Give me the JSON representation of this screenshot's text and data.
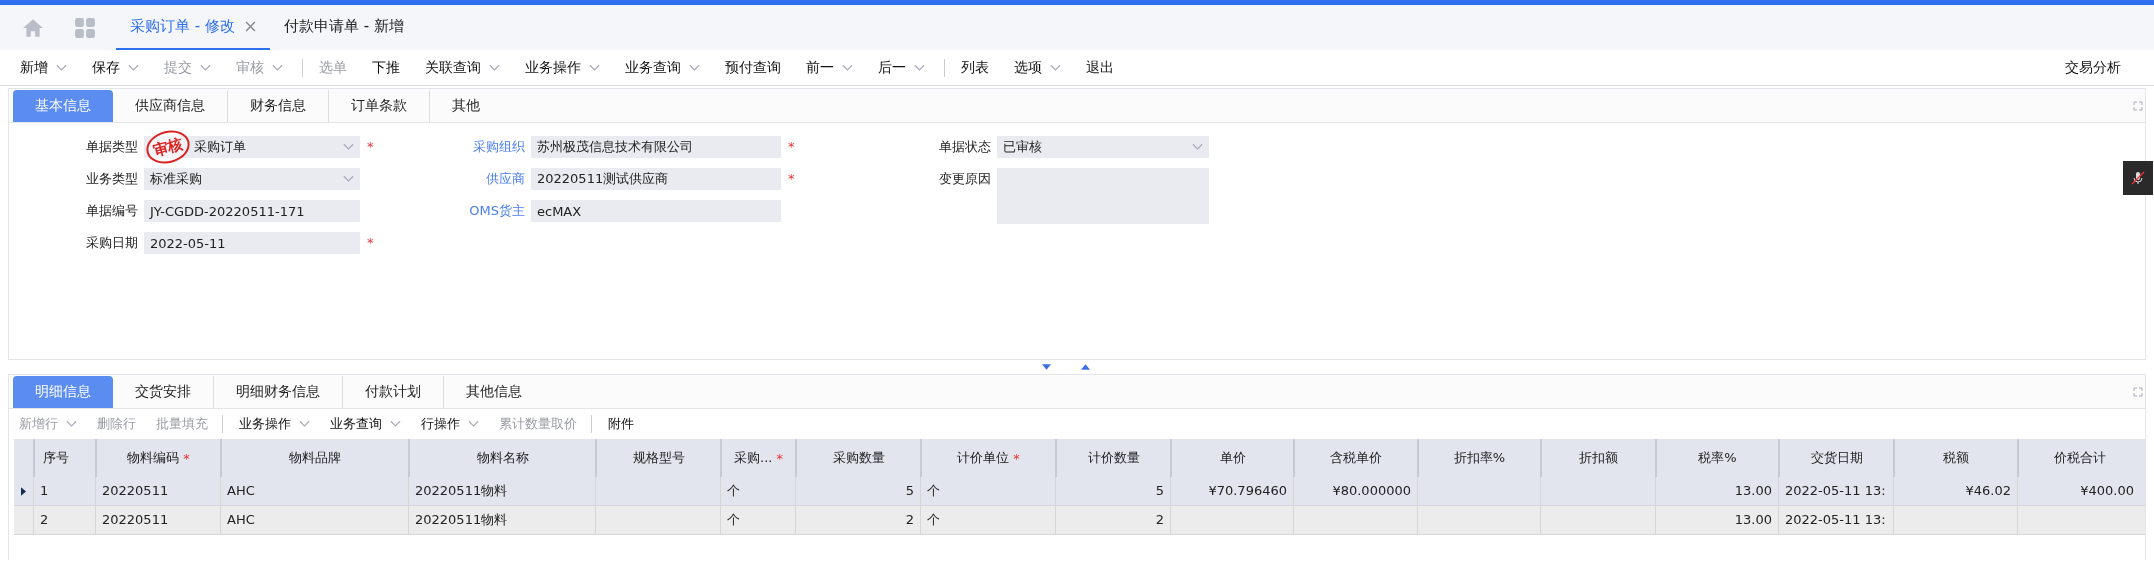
{
  "doc_tabs": [
    {
      "label": "采购订单 - 修改",
      "selected": true,
      "closable": true
    },
    {
      "label": "付款申请单 - 新增",
      "selected": false,
      "closable": false
    }
  ],
  "toolbar": {
    "items": [
      {
        "label": "新增",
        "dropdown": true,
        "disabled": false
      },
      {
        "label": "保存",
        "dropdown": true,
        "disabled": false
      },
      {
        "label": "提交",
        "dropdown": true,
        "disabled": true
      },
      {
        "label": "审核",
        "dropdown": true,
        "disabled": true,
        "divider_after": true
      },
      {
        "label": "选单",
        "dropdown": false,
        "disabled": true
      },
      {
        "label": "下推",
        "dropdown": false,
        "disabled": false
      },
      {
        "label": "关联查询",
        "dropdown": true,
        "disabled": false
      },
      {
        "label": "业务操作",
        "dropdown": true,
        "disabled": false
      },
      {
        "label": "业务查询",
        "dropdown": true,
        "disabled": false
      },
      {
        "label": "预付查询",
        "dropdown": false,
        "disabled": false
      },
      {
        "label": "前一",
        "dropdown": true,
        "disabled": false
      },
      {
        "label": "后一",
        "dropdown": true,
        "disabled": false,
        "divider_after": true
      },
      {
        "label": "列表",
        "dropdown": false,
        "disabled": false
      },
      {
        "label": "选项",
        "dropdown": true,
        "disabled": false
      },
      {
        "label": "退出",
        "dropdown": false,
        "disabled": false
      }
    ],
    "right": "交易分析"
  },
  "header_tabs": [
    {
      "label": "基本信息",
      "selected": true
    },
    {
      "label": "供应商信息",
      "selected": false
    },
    {
      "label": "财务信息",
      "selected": false
    },
    {
      "label": "订单条款",
      "selected": false
    },
    {
      "label": "其他",
      "selected": false
    }
  ],
  "stamp": "审核",
  "form_columns": [
    [
      {
        "label": "单据类型",
        "value": "采购订单",
        "kind": "select",
        "required_mark": "*",
        "link": false,
        "stamped": true
      },
      {
        "label": "业务类型",
        "value": "标准采购",
        "kind": "select",
        "link": false,
        "stamped": false
      },
      {
        "label": "单据编号",
        "value": "JY-CGDD-20220511-171",
        "kind": "text",
        "link": false,
        "stamped": false
      },
      {
        "label": "采购日期",
        "value": "2022-05-11",
        "kind": "text",
        "required_mark": "*",
        "link": false,
        "stamped": false
      }
    ],
    [
      {
        "label": "采购组织",
        "value": "苏州极茂信息技术有限公司",
        "kind": "text",
        "required_mark": "*",
        "link": true,
        "stamped": false
      },
      {
        "label": "供应商",
        "value": "20220511测试供应商",
        "kind": "text",
        "required_mark": "*",
        "link": true,
        "stamped": false
      },
      {
        "label": "OMS货主",
        "value": "ecMAX",
        "kind": "text",
        "link": true,
        "stamped": false
      }
    ],
    [
      {
        "label": "单据状态",
        "value": "已审核",
        "kind": "select",
        "link": false,
        "stamped": false
      },
      {
        "label": "变更原因",
        "kind": "textarea",
        "link": false,
        "stamped": false
      }
    ]
  ],
  "detail_tabs": [
    {
      "label": "明细信息",
      "selected": true
    },
    {
      "label": "交货安排",
      "selected": false
    },
    {
      "label": "明细财务信息",
      "selected": false
    },
    {
      "label": "付款计划",
      "selected": false
    },
    {
      "label": "其他信息",
      "selected": false
    }
  ],
  "detail_toolbar": [
    {
      "label": "新增行",
      "dropdown": true,
      "disabled": true
    },
    {
      "label": "删除行",
      "dropdown": false,
      "disabled": true
    },
    {
      "label": "批量填充",
      "dropdown": false,
      "disabled": true,
      "divider_after": true
    },
    {
      "label": "业务操作",
      "dropdown": true,
      "disabled": false
    },
    {
      "label": "业务查询",
      "dropdown": true,
      "disabled": false
    },
    {
      "label": "行操作",
      "dropdown": true,
      "disabled": false
    },
    {
      "label": "累计数量取价",
      "dropdown": false,
      "disabled": true,
      "divider_after": true
    },
    {
      "label": "附件",
      "dropdown": false,
      "disabled": false
    }
  ],
  "table": {
    "columns": [
      {
        "label": "序号"
      },
      {
        "label": "物料编码",
        "required_mark": "*"
      },
      {
        "label": "物料品牌"
      },
      {
        "label": "物料名称"
      },
      {
        "label": "规格型号"
      },
      {
        "label": "采购...",
        "required_mark": "*"
      },
      {
        "label": "采购数量"
      },
      {
        "label": "计价单位",
        "required_mark": "*"
      },
      {
        "label": "计价数量"
      },
      {
        "label": "单价"
      },
      {
        "label": "含税单价"
      },
      {
        "label": "折扣率%"
      },
      {
        "label": "折扣额"
      },
      {
        "label": "税率%"
      },
      {
        "label": "交货日期"
      },
      {
        "label": "税额"
      },
      {
        "label": "价税合计"
      }
    ],
    "rows": [
      {
        "selected": true,
        "cells": [
          "1",
          "20220511",
          "AHC",
          "20220511物料",
          "",
          "个",
          "5",
          "个",
          "5",
          "¥70.796460",
          "¥80.000000",
          "",
          "",
          "13.00",
          "2022-05-11 13:",
          "¥46.02",
          "¥400.00"
        ]
      },
      {
        "selected": false,
        "cells": [
          "2",
          "20220511",
          "AHC",
          "20220511物料",
          "",
          "个",
          "2",
          "个",
          "2",
          "",
          "",
          "",
          "",
          "13.00",
          "2022-05-11 13:",
          "",
          ""
        ]
      }
    ]
  }
}
